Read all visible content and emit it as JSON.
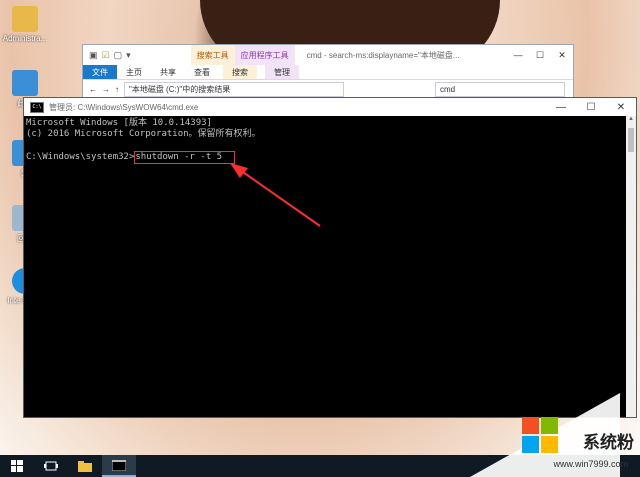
{
  "desktop": {
    "icons": [
      {
        "label": "Administra..."
      },
      {
        "label": "此电"
      },
      {
        "label": "网"
      },
      {
        "label": "回收"
      },
      {
        "label": "Inte Explo"
      }
    ]
  },
  "explorer": {
    "context_groups": [
      "搜索工具",
      "应用程序工具"
    ],
    "title": "cmd - search-ms:displayname=\"本地磁盘...",
    "ribbon_tabs": [
      "文件",
      "主页",
      "共享",
      "查看",
      "搜索",
      "管理"
    ],
    "address": "\"本地磁盘 (C:)\"中的搜索结果",
    "search_value": "cmd"
  },
  "cmd": {
    "title": "管理员: C:\\Windows\\SysWOW64\\cmd.exe",
    "lines": [
      "Microsoft Windows [版本 10.0.14393]",
      "(c) 2016 Microsoft Corporation。保留所有权利。"
    ],
    "prompt": "C:\\Windows\\system32>",
    "command": "shutdown -r -t 5"
  },
  "watermark": {
    "text": "系统粉",
    "url": "www.win7999.com",
    "colors": [
      "#f25022",
      "#7fba00",
      "#00a4ef",
      "#ffb900"
    ]
  },
  "annotation": {
    "color": "#ff2d2d"
  }
}
